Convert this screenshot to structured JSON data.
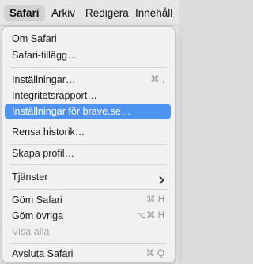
{
  "menubar": {
    "items": [
      "Safari",
      "Arkiv",
      "Redigera",
      "Innehåll"
    ]
  },
  "menu": {
    "items": [
      {
        "label": "Om Safari",
        "shortcut": ""
      },
      {
        "label": "Safari-tillägg…",
        "shortcut": ""
      },
      {
        "label": "Inställningar…",
        "shortcut": "⌘ ,"
      },
      {
        "label": "Integritetsrapport…",
        "shortcut": ""
      },
      {
        "label": "Inställningar för brave.se…",
        "shortcut": ""
      },
      {
        "label": "Rensa historik…",
        "shortcut": ""
      },
      {
        "label": "Skapa profil…",
        "shortcut": ""
      },
      {
        "label": "Tjänster",
        "shortcut": ""
      },
      {
        "label": "Göm Safari",
        "shortcut": "⌘ H"
      },
      {
        "label": "Göm övriga",
        "shortcut": "⌥⌘ H"
      },
      {
        "label": "Visa alla",
        "shortcut": ""
      },
      {
        "label": "Avsluta Safari",
        "shortcut": "⌘ Q"
      }
    ]
  },
  "colors": {
    "highlight": "#4f93f0",
    "menu_bg": "#f1f1f3",
    "disabled_text": "#a8a8ac"
  }
}
